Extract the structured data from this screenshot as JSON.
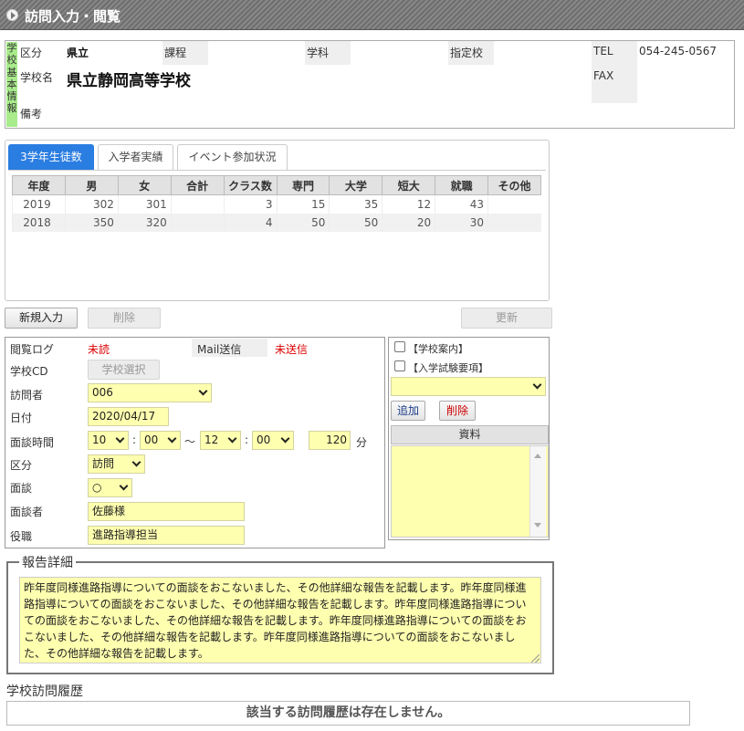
{
  "header": {
    "title": "訪問入力・閲覧"
  },
  "school_info": {
    "vertical_label": [
      "学",
      "校",
      "基",
      "本",
      "情",
      "報"
    ],
    "kubun_label": "区分",
    "kubun_value": "県立",
    "katei_label": "課程",
    "gakka_label": "学科",
    "shiteiko_label": "指定校",
    "tel_label": "TEL",
    "tel_value": "054-245-0567",
    "fax_label": "FAX",
    "name_label": "学校名",
    "name_value": "県立静岡高等学校",
    "note_label": "備考"
  },
  "tabs": [
    {
      "label": "3学年生徒数"
    },
    {
      "label": "入学者実績"
    },
    {
      "label": "イベント参加状況"
    }
  ],
  "stats_table": {
    "headers": [
      "年度",
      "男",
      "女",
      "合計",
      "クラス数",
      "専門",
      "大学",
      "短大",
      "就職",
      "その他"
    ],
    "rows": [
      [
        "2019",
        "302",
        "301",
        "",
        "3",
        "15",
        "35",
        "12",
        "43",
        ""
      ],
      [
        "2018",
        "350",
        "320",
        "",
        "4",
        "50",
        "50",
        "20",
        "30",
        ""
      ]
    ]
  },
  "buttons": {
    "new": "新規入力",
    "delete": "削除",
    "update": "更新"
  },
  "form": {
    "log_label": "閲覧ログ",
    "log_value": "未読",
    "mail_label": "Mail送信",
    "mail_value": "未送信",
    "school_cd_label": "学校CD",
    "school_select": "学校選択",
    "visitor_label": "訪問者",
    "visitor_value": "006",
    "date_label": "日付",
    "date_value": "2020/04/17",
    "time_label": "面談時間",
    "start_h": "10",
    "start_m": "00",
    "tilde": "～",
    "end_h": "12",
    "end_m": "00",
    "colon": ":",
    "duration": "120",
    "minute_unit": "分",
    "kubun_label": "区分",
    "kubun_value": "訪問",
    "mendan_label": "面談",
    "mendan_value": "○",
    "interviewee_label": "面談者",
    "interviewee_value": "佐藤様",
    "position_label": "役職",
    "position_value": "進路指導担当"
  },
  "materials": {
    "check1": "【学校案内】",
    "check2": "【入学試験要項】",
    "add": "追加",
    "delete": "削除",
    "header": "資料"
  },
  "report": {
    "legend": "報告詳細",
    "text": "昨年度同様進路指導についての面談をおこないました、その他詳細な報告を記載します。昨年度同様進路指導についての面談をおこないました、その他詳細な報告を記載します。昨年度同様進路指導についての面談をおこないました、その他詳細な報告を記載します。昨年度同様進路指導についての面談をおこないました、その他詳細な報告を記載します。昨年度同様進路指導についての面談をおこないました、その他詳細な報告を記載します。"
  },
  "history": {
    "title": "学校訪問履歴",
    "empty": "該当する訪問履歴は存在しません。"
  },
  "colors": {
    "tab_active": "#2a7de1",
    "input_yellow": "#ffffb0",
    "label_green": "#a8ec8c",
    "alert_red": "#dd0000"
  }
}
